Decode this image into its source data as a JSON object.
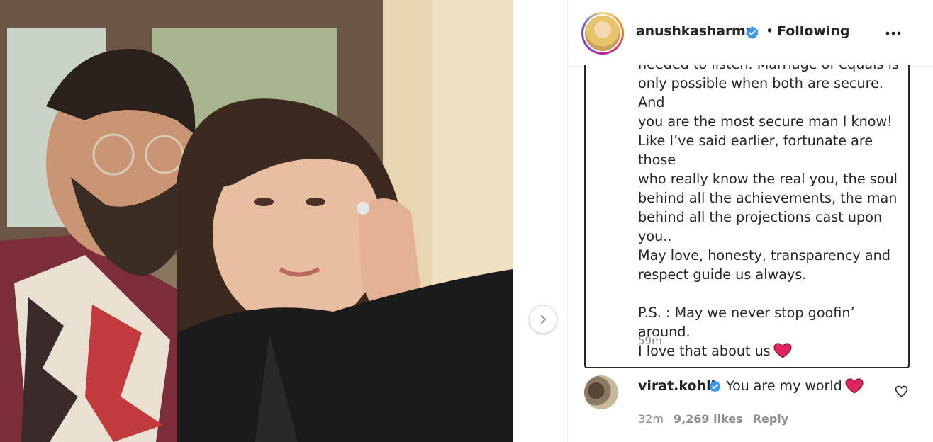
{
  "post": {
    "photo_alt": "",
    "next_icon": "chevron-right-icon"
  },
  "header": {
    "username": "anushkasharma",
    "separator": "•",
    "follow_state": "Following",
    "more_icon": "more-horizontal-icon"
  },
  "caption": {
    "lines": "needed to listen. Marriage of equals is\nonly possible when both are secure. And\nyou are the most secure man I know!\nLike I’ve said earlier, fortunate are those\nwho really know the real you, the soul\nbehind all the achievements, the man\nbehind all the projections cast upon\nyou..\nMay love, honesty, transparency and\nrespect guide us always.\n\nP.S. : May we never stop goofin’ around.\nI love that about us",
    "emoji": "red-heart-emoji",
    "time": "59m"
  },
  "comment": {
    "username": "virat.kohli",
    "text": "You are my world",
    "emoji": "red-heart-emoji",
    "time": "32m",
    "likes": "9,269 likes",
    "reply": "Reply"
  },
  "colors": {
    "verified": "#3897f0",
    "heart": "#e0245e",
    "text": "#262626",
    "muted": "#8e8e8e"
  }
}
